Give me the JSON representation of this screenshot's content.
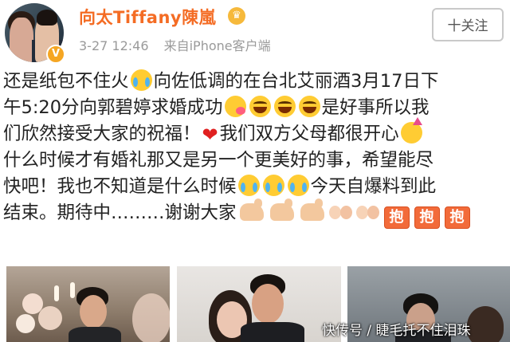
{
  "header": {
    "user_name": "向太Tiffany陳嵐",
    "timestamp": "3-27 12:46",
    "source": "来自iPhone客户端",
    "follow_label": "十关注",
    "avatar_icon": "avatar-photo",
    "verified_icon": "verified-v-icon",
    "member_icon": "crown-vip-icon"
  },
  "post": {
    "line1": [
      "还是纸包不住火",
      "向佐低调的在台北艾丽酒3月17日下"
    ],
    "line2": [
      "午5:20分向郭碧婷求婚成功",
      "是好事所以我"
    ],
    "line3": [
      "们欣然接受大家的祝福！",
      "我们双方父母都很开心"
    ],
    "line4": [
      "什么时候才有婚礼那又是另一个更美好的事，希望能尽"
    ],
    "line5": [
      "快吧！我也不知道是什么时候",
      "今天自爆料到此"
    ],
    "line6": [
      "结束。期待中………谢谢大家"
    ],
    "hug_label": "抱"
  },
  "watermark": "快传号 / 睫毛托不住泪珠",
  "colors": {
    "name": "#f46c24",
    "meta": "#9a9a9a",
    "text": "#222222"
  }
}
